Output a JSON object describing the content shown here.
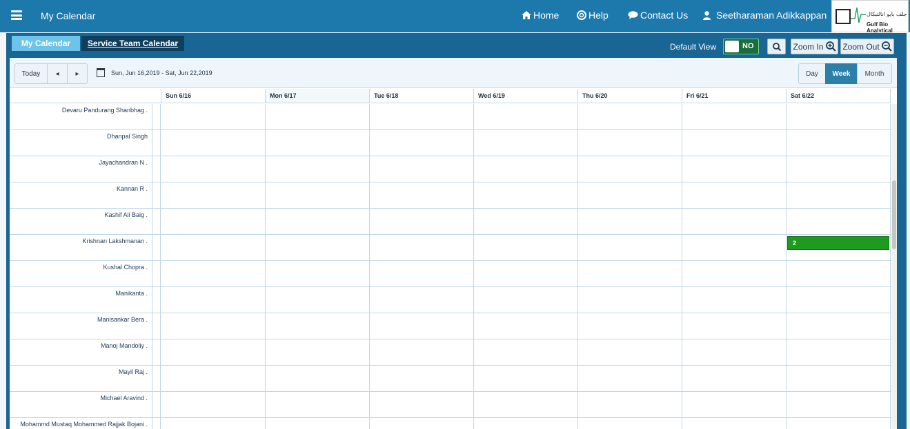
{
  "header": {
    "menu_icon": "hamburger-icon",
    "app_title": "My Calendar",
    "nav": [
      {
        "label": "Home",
        "icon": "home-icon"
      },
      {
        "label": "Help",
        "icon": "lifebuoy-icon"
      },
      {
        "label": "Contact Us",
        "icon": "chat-icon"
      }
    ],
    "user_name": "Seetharaman Adikkappan",
    "user_icon": "user-icon",
    "logo": {
      "arabic": "جلف بايو انالتيكال",
      "english": "Gulf Bio Analytical"
    }
  },
  "calendar_tabs": [
    {
      "label": "My Calendar",
      "active": true
    },
    {
      "label": "Service Team Calendar",
      "active": false
    }
  ],
  "controls": {
    "default_view_label": "Default View",
    "toggle_text": "NO",
    "zoom_in_label": "Zoom In",
    "zoom_out_label": "Zoom Out"
  },
  "toolbar": {
    "today_label": "Today",
    "prev_icon": "◂",
    "next_icon": "▸",
    "date_range": "Sun, Jun 16,2019 - Sat, Jun 22,2019",
    "views": [
      "Day",
      "Week",
      "Month"
    ],
    "active_view": "Week"
  },
  "days": [
    "Sun 6/16",
    "Mon 6/17",
    "Tue 6/18",
    "Wed 6/19",
    "Thu 6/20",
    "Fri 6/21",
    "Sat 6/22"
  ],
  "resources": [
    "Devaru Pandurang Shanbhag .",
    "Dhanpal Singh",
    "Jayachandran N .",
    "Kannan R .",
    "Kashif Ali Baig .",
    "Krishnan Lakshmanan .",
    "Kushal Chopra .",
    "Manikanta .",
    "Manisankar Bera .",
    "Manoj Mandoliy .",
    "Mayil Raj .",
    "Michael Aravind .",
    "Mohammd Mustaq Mohammed Rajjak Bojani ."
  ],
  "events": [
    {
      "resource": "Krishnan Lakshmanan .",
      "day": "Sat 6/22",
      "label": "2",
      "color": "#1e9a1e"
    }
  ],
  "colors": {
    "accent": "#1d79ac",
    "event": "#1e9a1e"
  }
}
